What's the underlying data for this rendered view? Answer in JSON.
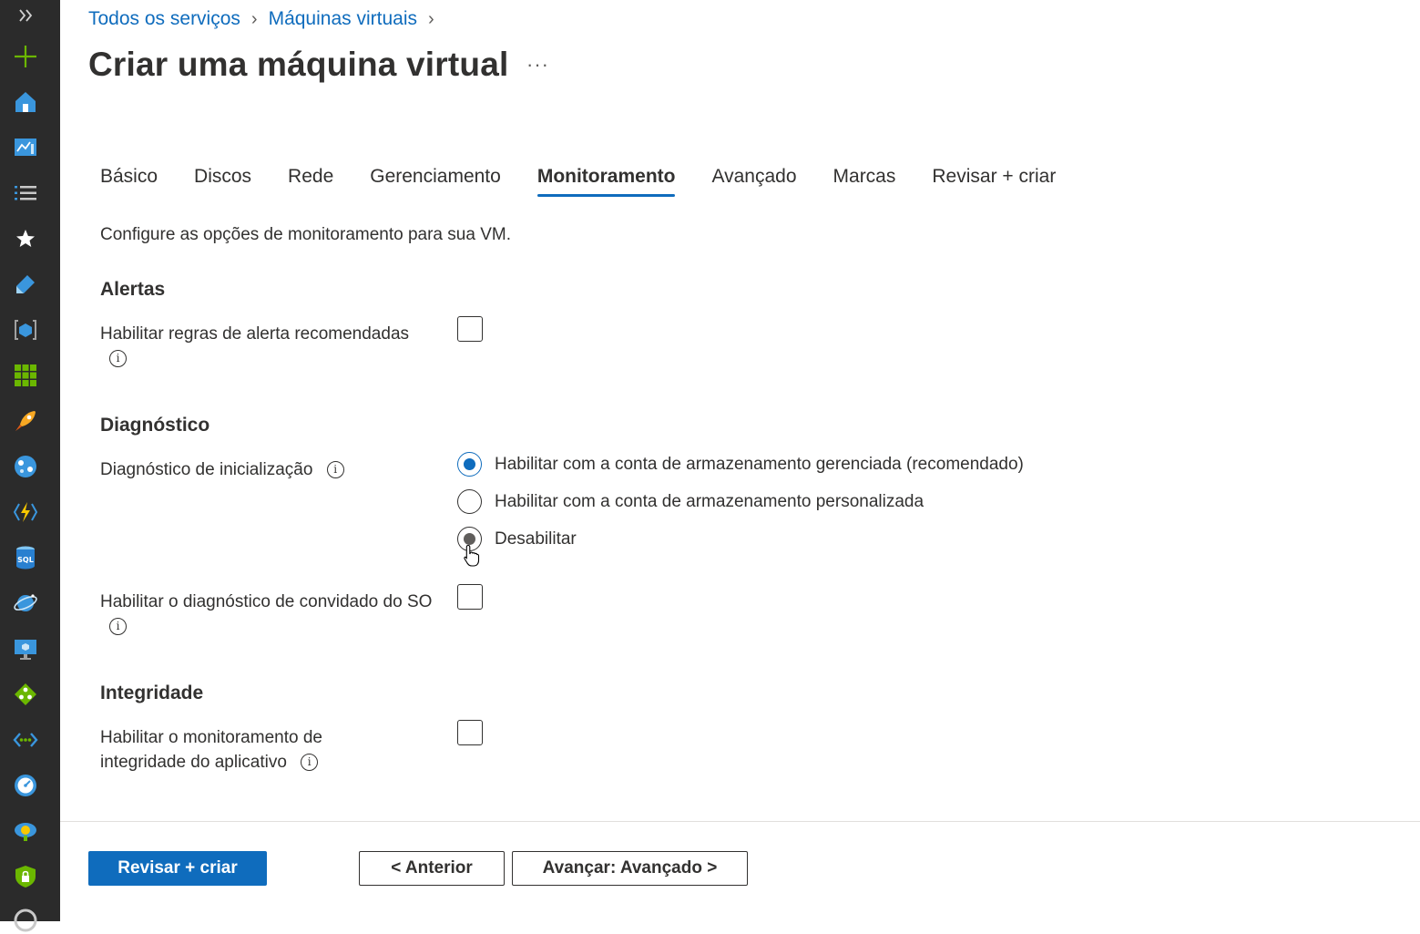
{
  "sidebar": {
    "items": [
      {
        "name": "expand-sidebar-icon"
      },
      {
        "name": "create-resource-icon"
      },
      {
        "name": "home-icon"
      },
      {
        "name": "dashboard-icon"
      },
      {
        "name": "all-services-icon"
      },
      {
        "name": "favorites-icon"
      },
      {
        "name": "devops-icon"
      },
      {
        "name": "resource-groups-icon"
      },
      {
        "name": "all-resources-icon"
      },
      {
        "name": "quickstart-icon"
      },
      {
        "name": "app-services-icon"
      },
      {
        "name": "function-app-icon"
      },
      {
        "name": "sql-databases-icon"
      },
      {
        "name": "cosmos-db-icon"
      },
      {
        "name": "virtual-machines-icon"
      },
      {
        "name": "load-balancers-icon"
      },
      {
        "name": "virtual-networks-icon"
      },
      {
        "name": "monitor-icon"
      },
      {
        "name": "advisor-icon"
      },
      {
        "name": "security-center-icon"
      }
    ]
  },
  "breadcrumb": {
    "items": [
      "Todos os serviços",
      "Máquinas virtuais"
    ]
  },
  "page_title": "Criar uma máquina virtual",
  "more_label": "···",
  "tabs": [
    {
      "label": "Básico"
    },
    {
      "label": "Discos"
    },
    {
      "label": "Rede"
    },
    {
      "label": "Gerenciamento"
    },
    {
      "label": "Monitoramento",
      "active": true
    },
    {
      "label": "Avançado"
    },
    {
      "label": "Marcas"
    },
    {
      "label": "Revisar + criar"
    }
  ],
  "description": "Configure as opções de monitoramento para sua VM.",
  "sections": {
    "alerts": {
      "title": "Alertas",
      "field_label": "Habilitar regras de alerta recomendadas",
      "checked": false
    },
    "diagnostics": {
      "title": "Diagnóstico",
      "boot_label": "Diagnóstico de inicialização",
      "boot_options": [
        "Habilitar com a conta de armazenamento gerenciada (recomendado)",
        "Habilitar com a conta de armazenamento personalizada",
        "Desabilitar"
      ],
      "boot_selected": "Habilitar com a conta de armazenamento gerenciada (recomendado)",
      "guest_label": "Habilitar o diagnóstico de convidado do SO",
      "guest_checked": false
    },
    "health": {
      "title": "Integridade",
      "field_label": "Habilitar o monitoramento de integridade do aplicativo",
      "checked": false
    }
  },
  "footer": {
    "review_create": "Revisar + criar",
    "previous": "< Anterior",
    "next": "Avançar: Avançado >"
  },
  "colors": {
    "accent": "#0f6cbd",
    "sidebar_bg": "#2b2b2b"
  }
}
